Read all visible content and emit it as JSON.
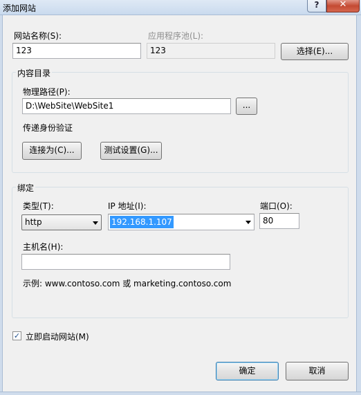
{
  "window": {
    "title": "添加网站",
    "help_glyph": "?",
    "close_glyph": "✕"
  },
  "site_name": {
    "label": "网站名称(S):",
    "value": "123"
  },
  "app_pool": {
    "label": "应用程序池(L):",
    "value": "123",
    "select_button": "选择(E)..."
  },
  "content_dir": {
    "group_title": "内容目录",
    "physical_path_label": "物理路径(P):",
    "physical_path_value": "D:\\WebSite\\WebSite1",
    "browse_button": "...",
    "pass_through_label": "传递身份验证",
    "connect_as_button": "连接为(C)...",
    "test_settings_button": "测试设置(G)..."
  },
  "binding": {
    "group_title": "绑定",
    "type_label": "类型(T):",
    "type_value": "http",
    "ip_label": "IP 地址(I):",
    "ip_value": "192.168.1.107",
    "port_label": "端口(O):",
    "port_value": "80",
    "host_label": "主机名(H):",
    "host_value": "",
    "example_text": "示例: www.contoso.com 或 marketing.contoso.com"
  },
  "start_immediately": {
    "label": "立即启动网站(M)",
    "checked": true,
    "check_glyph": "✓"
  },
  "footer": {
    "ok_button": "确定",
    "cancel_button": "取消"
  }
}
